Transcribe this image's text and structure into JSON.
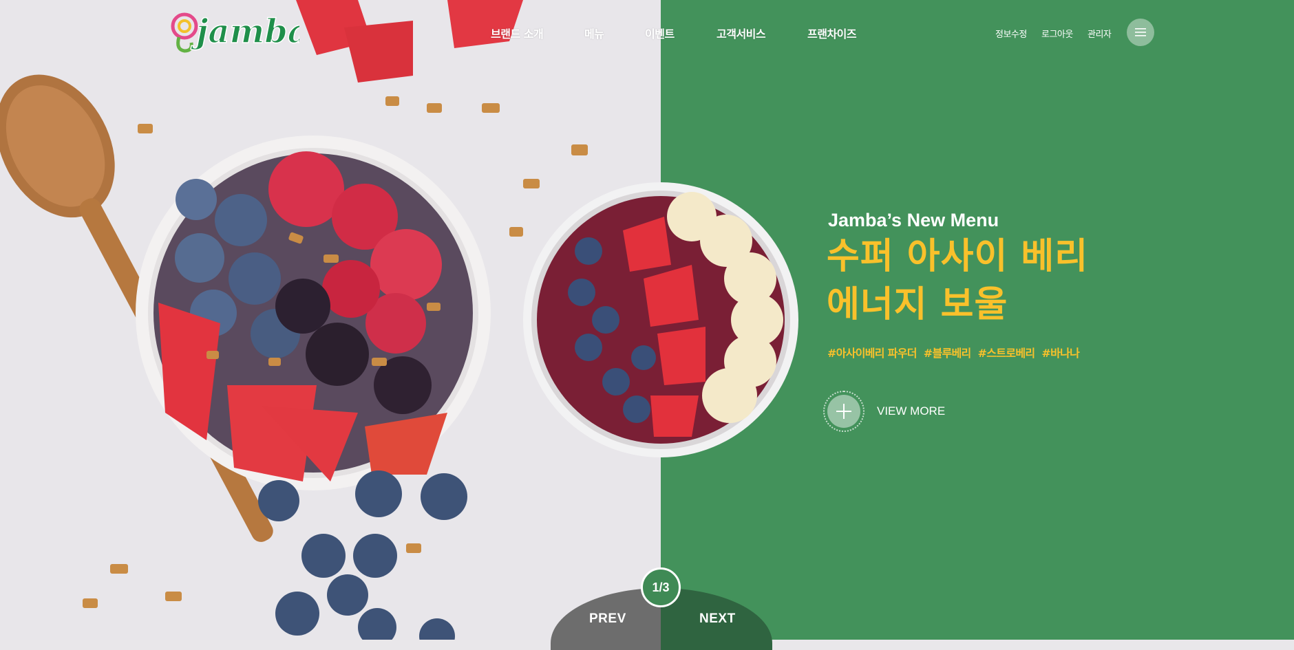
{
  "brand": {
    "logo_text": "jamba"
  },
  "nav": {
    "items": [
      "브랜드 소개",
      "메뉴",
      "이벤트",
      "고객서비스",
      "프랜차이즈"
    ]
  },
  "util": {
    "edit_profile": "정보수정",
    "logout": "로그아웃",
    "admin": "관리자",
    "menu_icon": "hamburger-icon"
  },
  "hero": {
    "kicker": "Jamba’s New Menu",
    "title_line1": "수퍼 아사이 베리",
    "title_line2": "에너지 보울",
    "tags": [
      "#아사이베리 파우더",
      "#블루베리",
      "#스트로베리",
      "#바나나"
    ],
    "view_more": "VIEW MORE"
  },
  "pager": {
    "prev": "PREV",
    "next": "NEXT",
    "counter": "1/3"
  },
  "colors": {
    "green": "#43925b",
    "yellow": "#f9c12b",
    "dark_green": "#2f6440",
    "gray": "#6d6d6d"
  }
}
